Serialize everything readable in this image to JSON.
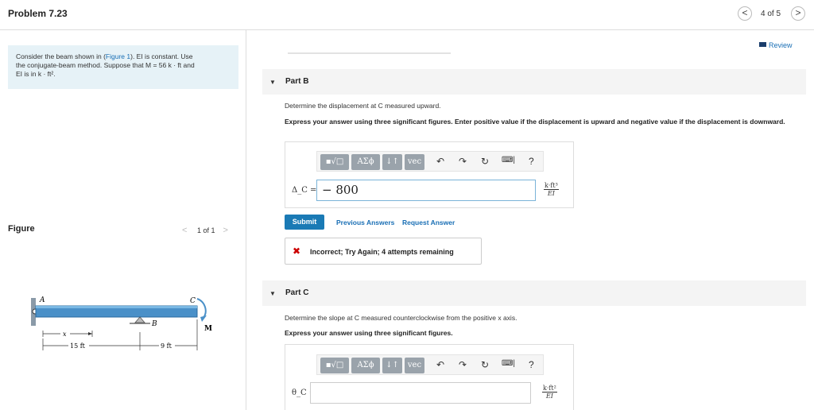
{
  "header": {
    "title": "Problem 7.23",
    "prev": "<",
    "pager": "4 of 5",
    "next": ">"
  },
  "problem": {
    "text_before_link": "Consider the beam shown in (",
    "link": "Figure 1",
    "text_after_link": "). EI is constant. Use",
    "line2": "the conjugate-beam method. Suppose that M = 56 k · ft and",
    "line3": "EI is in k · ft²."
  },
  "figure": {
    "label": "Figure",
    "prev": "<",
    "pager": "1 of 1",
    "next": ">",
    "labels": {
      "A": "A",
      "B": "B",
      "C": "C",
      "M": "M",
      "x": "x",
      "d1": "15 ft",
      "d2": "9 ft"
    }
  },
  "review": "Review",
  "partB": {
    "label": "Part B",
    "prompt": "Determine the displacement at C measured upward.",
    "instructions": "Express your answer using three significant figures. Enter positive value if the displacement is upward and negative value if the displacement is downward.",
    "toolbar": {
      "templates": "▪√□",
      "greek": "ΑΣϕ",
      "arrows": "↓↑",
      "vec": "vec",
      "undo": "↶",
      "redo": "↷",
      "reset": "↻",
      "keyboard": "⌨|",
      "help": "?"
    },
    "var_label": "Δ_C =",
    "input_value": "− 800",
    "units_num": "k·ft³",
    "units_den": "EI",
    "submit": "Submit",
    "previous_answers": "Previous Answers",
    "request_answer": "Request Answer",
    "feedback": "Incorrect; Try Again; 4 attempts remaining"
  },
  "partC": {
    "label": "Part C",
    "prompt": "Determine the slope at C measured counterclockwise from the positive x axis.",
    "instructions": "Express your answer using three significant figures.",
    "toolbar": {
      "templates": "▪√□",
      "greek": "ΑΣϕ",
      "arrows": "↓↑",
      "vec": "vec",
      "undo": "↶",
      "redo": "↷",
      "reset": "↻",
      "keyboard": "⌨|",
      "help": "?"
    },
    "var_label": "θ_C =",
    "input_value": "",
    "units_num": "k·ft²",
    "units_den": "EI"
  }
}
